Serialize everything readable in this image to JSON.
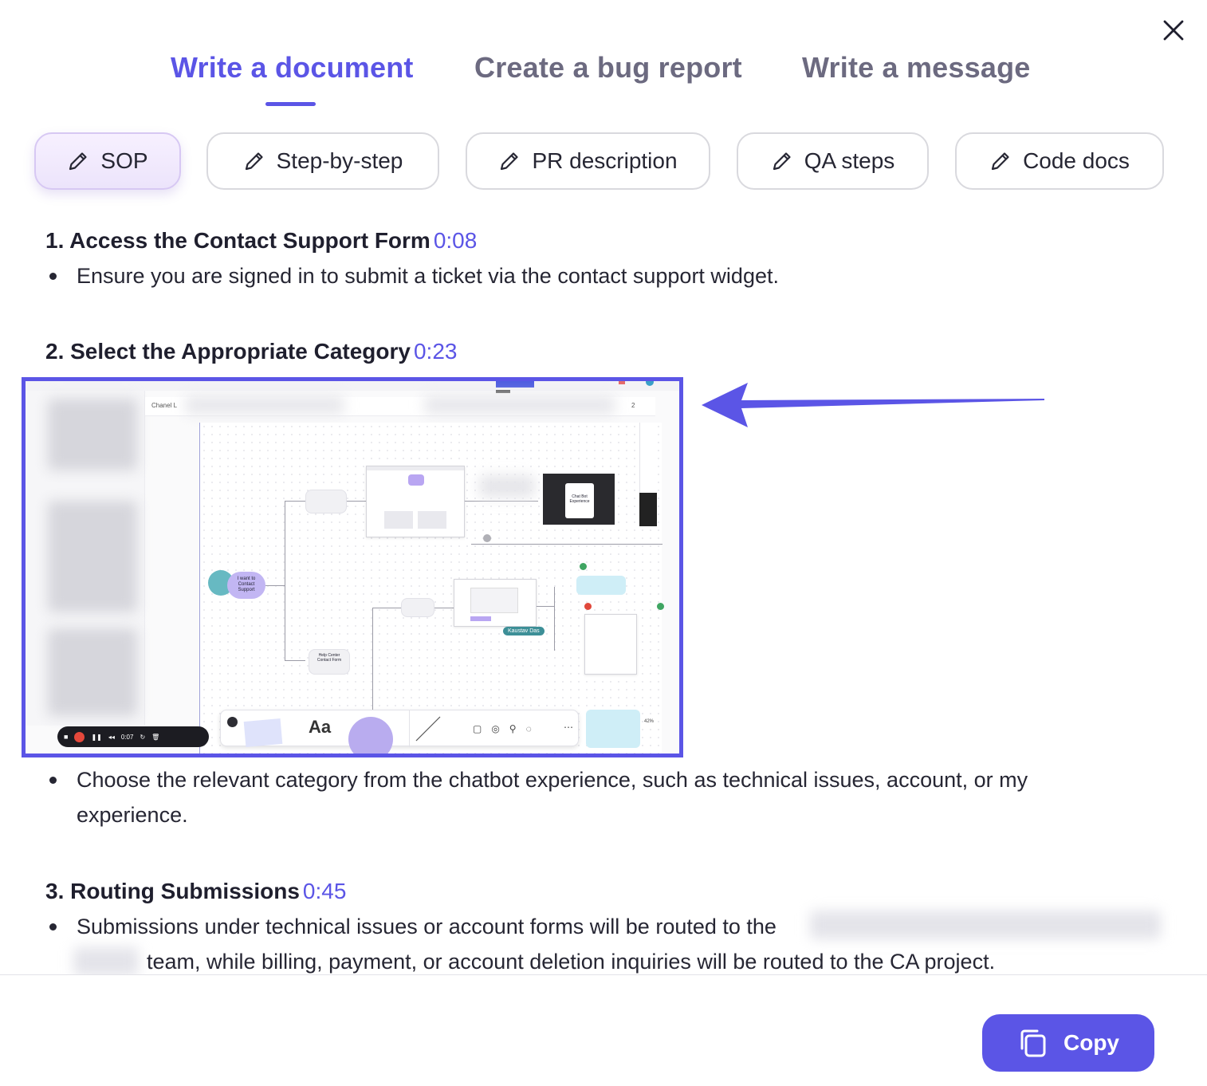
{
  "tabs": [
    {
      "label": "Write a document",
      "active": true
    },
    {
      "label": "Create a bug report",
      "active": false
    },
    {
      "label": "Write a message",
      "active": false
    }
  ],
  "chips": [
    {
      "label": "SOP",
      "icon": "pencil-icon",
      "active": true
    },
    {
      "label": "Step-by-step",
      "icon": "pencil-icon",
      "active": false
    },
    {
      "label": "PR description",
      "icon": "pencil-icon",
      "active": false
    },
    {
      "label": "QA steps",
      "icon": "pencil-icon",
      "active": false
    },
    {
      "label": "Code docs",
      "icon": "pencil-icon",
      "active": false
    }
  ],
  "sections": [
    {
      "title": "1. Access the Contact Support Form",
      "timestamp": "0:08",
      "bullets": [
        "Ensure you are signed in to submit a ticket via the contact support widget."
      ]
    },
    {
      "title": "2. Select the Appropriate Category",
      "timestamp": "0:23",
      "bullets": [
        "Choose the relevant category from the chatbot experience, such as technical issues, account, or my",
        "experience."
      ]
    },
    {
      "title": "3. Routing Submissions",
      "timestamp": "0:45",
      "bullets": [
        "Submissions under technical issues or account forms will be routed to the",
        "team, while billing, payment, or account deletion inquiries will be routed to the CA project."
      ]
    }
  ],
  "screenshot": {
    "channel_label": "Chanel L",
    "start_node": "I want to Contact Support",
    "help_contact": "Help Center Contact Form",
    "chatbot_node": "Chat Bot Experience",
    "cursor_label": "Kaustav Das",
    "recording_time": "0:07",
    "toolbar_text": "Aa",
    "zoom_level": "42%",
    "page_number": "2"
  },
  "footer": {
    "copy_label": "Copy"
  },
  "colors": {
    "accent": "#5b55e6",
    "tab_inactive": "#6c6a80"
  }
}
